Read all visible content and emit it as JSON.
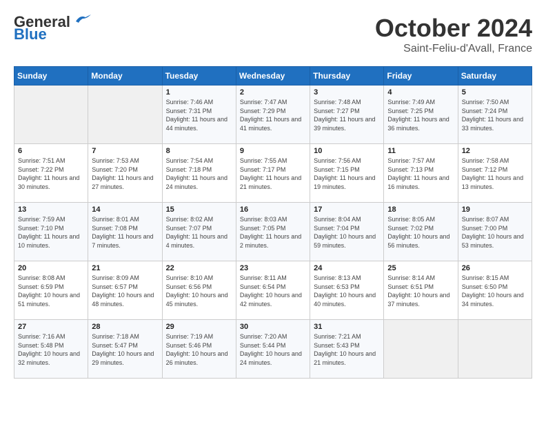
{
  "header": {
    "logo_general": "General",
    "logo_blue": "Blue",
    "month": "October 2024",
    "location": "Saint-Feliu-d'Avall, France"
  },
  "days_of_week": [
    "Sunday",
    "Monday",
    "Tuesday",
    "Wednesday",
    "Thursday",
    "Friday",
    "Saturday"
  ],
  "weeks": [
    [
      {
        "day": "",
        "sunrise": "",
        "sunset": "",
        "daylight": ""
      },
      {
        "day": "",
        "sunrise": "",
        "sunset": "",
        "daylight": ""
      },
      {
        "day": "1",
        "sunrise": "Sunrise: 7:46 AM",
        "sunset": "Sunset: 7:31 PM",
        "daylight": "Daylight: 11 hours and 44 minutes."
      },
      {
        "day": "2",
        "sunrise": "Sunrise: 7:47 AM",
        "sunset": "Sunset: 7:29 PM",
        "daylight": "Daylight: 11 hours and 41 minutes."
      },
      {
        "day": "3",
        "sunrise": "Sunrise: 7:48 AM",
        "sunset": "Sunset: 7:27 PM",
        "daylight": "Daylight: 11 hours and 39 minutes."
      },
      {
        "day": "4",
        "sunrise": "Sunrise: 7:49 AM",
        "sunset": "Sunset: 7:25 PM",
        "daylight": "Daylight: 11 hours and 36 minutes."
      },
      {
        "day": "5",
        "sunrise": "Sunrise: 7:50 AM",
        "sunset": "Sunset: 7:24 PM",
        "daylight": "Daylight: 11 hours and 33 minutes."
      }
    ],
    [
      {
        "day": "6",
        "sunrise": "Sunrise: 7:51 AM",
        "sunset": "Sunset: 7:22 PM",
        "daylight": "Daylight: 11 hours and 30 minutes."
      },
      {
        "day": "7",
        "sunrise": "Sunrise: 7:53 AM",
        "sunset": "Sunset: 7:20 PM",
        "daylight": "Daylight: 11 hours and 27 minutes."
      },
      {
        "day": "8",
        "sunrise": "Sunrise: 7:54 AM",
        "sunset": "Sunset: 7:18 PM",
        "daylight": "Daylight: 11 hours and 24 minutes."
      },
      {
        "day": "9",
        "sunrise": "Sunrise: 7:55 AM",
        "sunset": "Sunset: 7:17 PM",
        "daylight": "Daylight: 11 hours and 21 minutes."
      },
      {
        "day": "10",
        "sunrise": "Sunrise: 7:56 AM",
        "sunset": "Sunset: 7:15 PM",
        "daylight": "Daylight: 11 hours and 19 minutes."
      },
      {
        "day": "11",
        "sunrise": "Sunrise: 7:57 AM",
        "sunset": "Sunset: 7:13 PM",
        "daylight": "Daylight: 11 hours and 16 minutes."
      },
      {
        "day": "12",
        "sunrise": "Sunrise: 7:58 AM",
        "sunset": "Sunset: 7:12 PM",
        "daylight": "Daylight: 11 hours and 13 minutes."
      }
    ],
    [
      {
        "day": "13",
        "sunrise": "Sunrise: 7:59 AM",
        "sunset": "Sunset: 7:10 PM",
        "daylight": "Daylight: 11 hours and 10 minutes."
      },
      {
        "day": "14",
        "sunrise": "Sunrise: 8:01 AM",
        "sunset": "Sunset: 7:08 PM",
        "daylight": "Daylight: 11 hours and 7 minutes."
      },
      {
        "day": "15",
        "sunrise": "Sunrise: 8:02 AM",
        "sunset": "Sunset: 7:07 PM",
        "daylight": "Daylight: 11 hours and 4 minutes."
      },
      {
        "day": "16",
        "sunrise": "Sunrise: 8:03 AM",
        "sunset": "Sunset: 7:05 PM",
        "daylight": "Daylight: 11 hours and 2 minutes."
      },
      {
        "day": "17",
        "sunrise": "Sunrise: 8:04 AM",
        "sunset": "Sunset: 7:04 PM",
        "daylight": "Daylight: 10 hours and 59 minutes."
      },
      {
        "day": "18",
        "sunrise": "Sunrise: 8:05 AM",
        "sunset": "Sunset: 7:02 PM",
        "daylight": "Daylight: 10 hours and 56 minutes."
      },
      {
        "day": "19",
        "sunrise": "Sunrise: 8:07 AM",
        "sunset": "Sunset: 7:00 PM",
        "daylight": "Daylight: 10 hours and 53 minutes."
      }
    ],
    [
      {
        "day": "20",
        "sunrise": "Sunrise: 8:08 AM",
        "sunset": "Sunset: 6:59 PM",
        "daylight": "Daylight: 10 hours and 51 minutes."
      },
      {
        "day": "21",
        "sunrise": "Sunrise: 8:09 AM",
        "sunset": "Sunset: 6:57 PM",
        "daylight": "Daylight: 10 hours and 48 minutes."
      },
      {
        "day": "22",
        "sunrise": "Sunrise: 8:10 AM",
        "sunset": "Sunset: 6:56 PM",
        "daylight": "Daylight: 10 hours and 45 minutes."
      },
      {
        "day": "23",
        "sunrise": "Sunrise: 8:11 AM",
        "sunset": "Sunset: 6:54 PM",
        "daylight": "Daylight: 10 hours and 42 minutes."
      },
      {
        "day": "24",
        "sunrise": "Sunrise: 8:13 AM",
        "sunset": "Sunset: 6:53 PM",
        "daylight": "Daylight: 10 hours and 40 minutes."
      },
      {
        "day": "25",
        "sunrise": "Sunrise: 8:14 AM",
        "sunset": "Sunset: 6:51 PM",
        "daylight": "Daylight: 10 hours and 37 minutes."
      },
      {
        "day": "26",
        "sunrise": "Sunrise: 8:15 AM",
        "sunset": "Sunset: 6:50 PM",
        "daylight": "Daylight: 10 hours and 34 minutes."
      }
    ],
    [
      {
        "day": "27",
        "sunrise": "Sunrise: 7:16 AM",
        "sunset": "Sunset: 5:48 PM",
        "daylight": "Daylight: 10 hours and 32 minutes."
      },
      {
        "day": "28",
        "sunrise": "Sunrise: 7:18 AM",
        "sunset": "Sunset: 5:47 PM",
        "daylight": "Daylight: 10 hours and 29 minutes."
      },
      {
        "day": "29",
        "sunrise": "Sunrise: 7:19 AM",
        "sunset": "Sunset: 5:46 PM",
        "daylight": "Daylight: 10 hours and 26 minutes."
      },
      {
        "day": "30",
        "sunrise": "Sunrise: 7:20 AM",
        "sunset": "Sunset: 5:44 PM",
        "daylight": "Daylight: 10 hours and 24 minutes."
      },
      {
        "day": "31",
        "sunrise": "Sunrise: 7:21 AM",
        "sunset": "Sunset: 5:43 PM",
        "daylight": "Daylight: 10 hours and 21 minutes."
      },
      {
        "day": "",
        "sunrise": "",
        "sunset": "",
        "daylight": ""
      },
      {
        "day": "",
        "sunrise": "",
        "sunset": "",
        "daylight": ""
      }
    ]
  ]
}
